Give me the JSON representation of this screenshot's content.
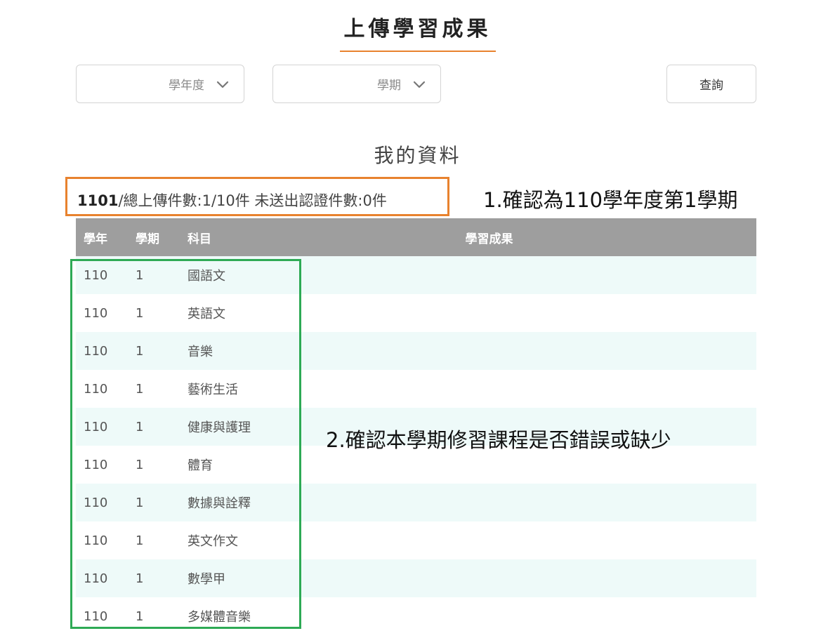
{
  "header": {
    "title": "上傳學習成果"
  },
  "filters": {
    "year_label": "學年度",
    "term_label": "學期",
    "query_label": "查詢"
  },
  "section": {
    "title": "我的資料"
  },
  "summary": {
    "code": "1101",
    "rest": "/總上傳件數:1/10件 未送出認證件數:0件"
  },
  "annotations": {
    "note1": "1.確認為110學年度第1學期",
    "note2": "2.確認本學期修習課程是否錯誤或缺少"
  },
  "table": {
    "headers": {
      "year": "學年",
      "term": "學期",
      "subject": "科目",
      "result": "學習成果"
    },
    "rows": [
      {
        "year": "110",
        "term": "1",
        "subject": "國語文"
      },
      {
        "year": "110",
        "term": "1",
        "subject": "英語文"
      },
      {
        "year": "110",
        "term": "1",
        "subject": "音樂"
      },
      {
        "year": "110",
        "term": "1",
        "subject": "藝術生活"
      },
      {
        "year": "110",
        "term": "1",
        "subject": "健康與護理"
      },
      {
        "year": "110",
        "term": "1",
        "subject": "體育"
      },
      {
        "year": "110",
        "term": "1",
        "subject": "數據與詮釋"
      },
      {
        "year": "110",
        "term": "1",
        "subject": "英文作文"
      },
      {
        "year": "110",
        "term": "1",
        "subject": "數學甲"
      },
      {
        "year": "110",
        "term": "1",
        "subject": "多媒體音樂"
      }
    ]
  },
  "colors": {
    "accent_orange": "#e8822e",
    "highlight_green": "#2eaa55",
    "table_header": "#9e9e9e",
    "row_stripe": "#eefaf9"
  },
  "icons": {
    "dropdown": "chevron-down-icon"
  }
}
